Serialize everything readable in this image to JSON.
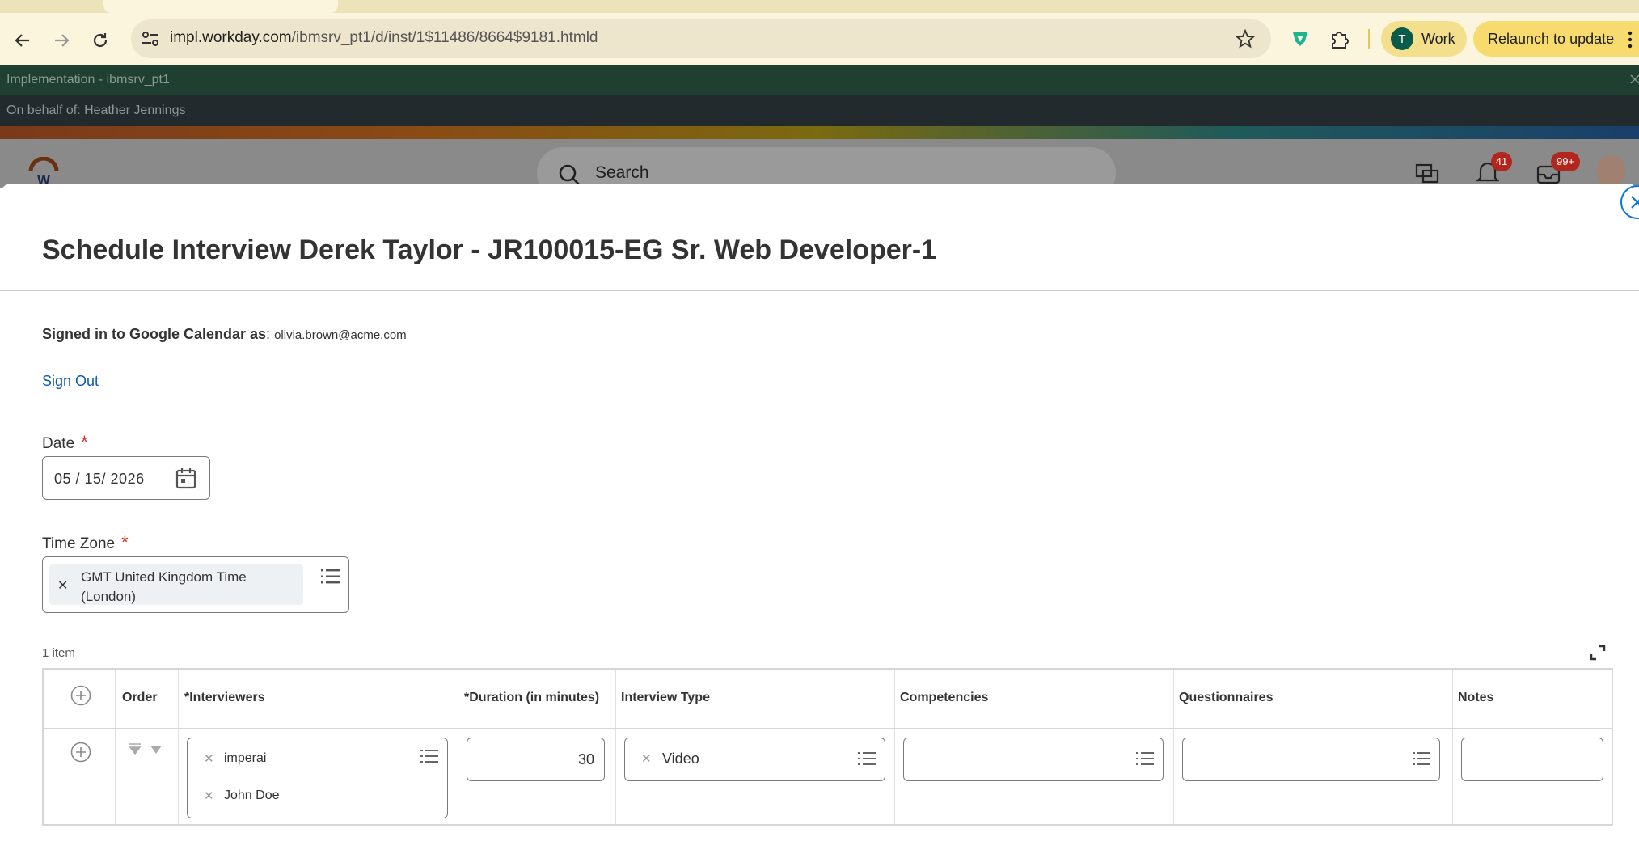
{
  "browser": {
    "url_host": "impl.workday.com",
    "url_path": "/ibmsrv_pt1/d/inst/1$11486/8664$9181.htmld",
    "profile_initial": "T",
    "profile_label": "Work",
    "relaunch_label": "Relaunch to update"
  },
  "workday": {
    "tenant": "Implementation - ibmsrv_pt1",
    "on_behalf": "On behalf of: Heather Jennings",
    "search_placeholder": "Search",
    "notifications_count": "41",
    "inbox_count": "99+"
  },
  "modal": {
    "title": "Schedule Interview Derek Taylor - JR100015-EG Sr. Web Developer-1",
    "signed_in_label": "Signed in to Google Calendar as",
    "signed_in_email": "olivia.brown@acme.com",
    "sign_out": "Sign Out",
    "date_label": "Date",
    "date_value": "05 / 15/ 2026",
    "timezone_label": "Time Zone",
    "timezone_value": "GMT United Kingdom Time (London)",
    "item_count": "1 item"
  },
  "grid": {
    "headers": {
      "order": "Order",
      "interviewers": "*Interviewers",
      "duration": "*Duration (in minutes)",
      "interview_type": "Interview Type",
      "competencies": "Competencies",
      "questionnaires": "Questionnaires",
      "notes": "Notes"
    },
    "row": {
      "interviewers": [
        "imperai",
        "John Doe"
      ],
      "duration": "30",
      "interview_type": "Video",
      "competencies": "",
      "questionnaires": "",
      "notes": ""
    }
  },
  "colors": {
    "accent": "#0875e1",
    "required": "#de2e21",
    "badge": "#b3261e"
  }
}
